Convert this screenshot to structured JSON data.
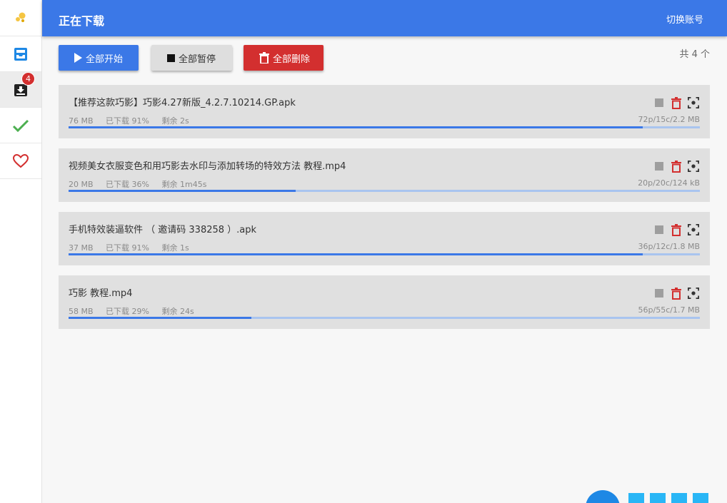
{
  "header": {
    "title": "正在下载",
    "switch_account": "切换账号"
  },
  "sidebar": {
    "download_badge": "4"
  },
  "toolbar": {
    "start_all": "全部开始",
    "pause_all": "全部暂停",
    "delete_all": "全部删除",
    "count": "共 4 个"
  },
  "colors": {
    "primary": "#3b78e7",
    "danger": "#d32f2f",
    "success": "#4caf50"
  },
  "downloads": [
    {
      "name": "【推荐这款巧影】巧影4.27新版_4.2.7.10214.GP.apk",
      "size": "76 MB",
      "progress_text": "已下载 91%",
      "remaining": "剩余 2s",
      "peers": "72p/15c/2.2 MB",
      "progress": 91
    },
    {
      "name": "视频美女衣服变色和用巧影去水印与添加转场的特效方法 教程.mp4",
      "size": "20 MB",
      "progress_text": "已下载 36%",
      "remaining": "剩余 1m45s",
      "peers": "20p/20c/124 kB",
      "progress": 36
    },
    {
      "name": "手机特效装逼软件 （ 邀请码 338258 ）.apk",
      "size": "37 MB",
      "progress_text": "已下载 91%",
      "remaining": "剩余 1s",
      "peers": "36p/12c/1.8 MB",
      "progress": 91
    },
    {
      "name": "巧影 教程.mp4",
      "size": "58 MB",
      "progress_text": "已下载 29%",
      "remaining": "剩余 24s",
      "peers": "56p/55c/1.7 MB",
      "progress": 29
    }
  ]
}
